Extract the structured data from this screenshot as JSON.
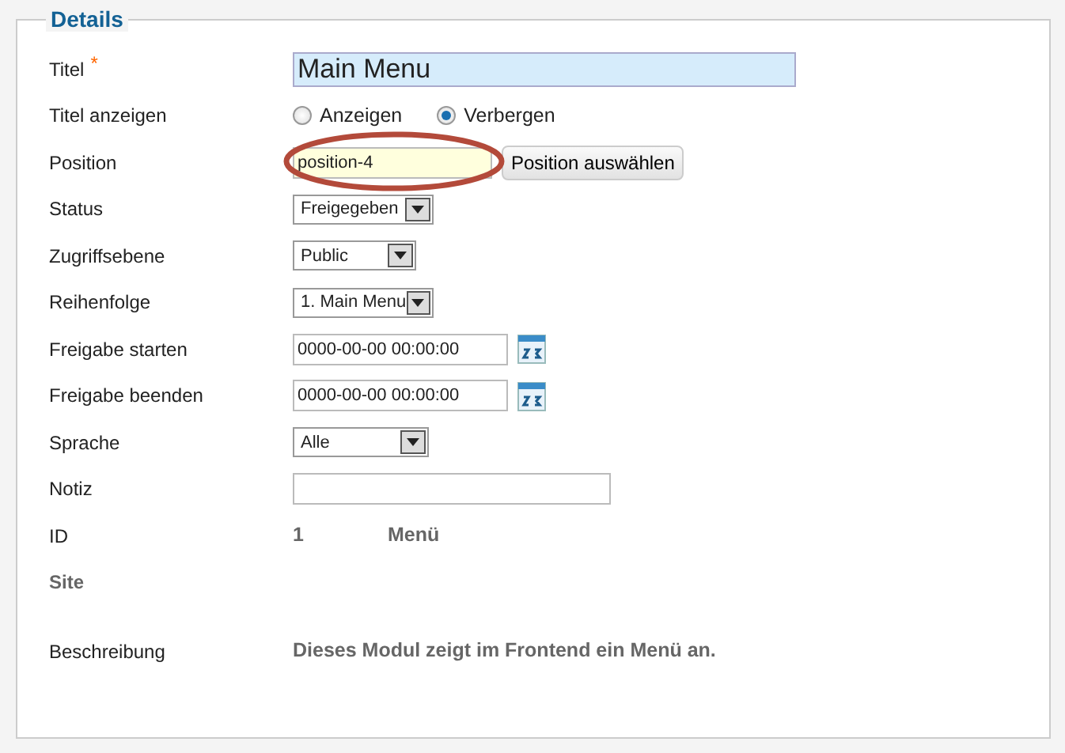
{
  "legend": "Details",
  "fields": [
    {
      "kind": "text",
      "label": "Titel",
      "required": true,
      "required_mark": "*",
      "value": "Main Menu",
      "focused": true,
      "large": true
    },
    {
      "kind": "radio",
      "label": "Titel anzeigen",
      "options": [
        {
          "label": "Anzeigen",
          "selected": false
        },
        {
          "label": "Verbergen",
          "selected": true
        }
      ]
    },
    {
      "kind": "picker",
      "label": "Position",
      "value": "position-4",
      "readonly": true,
      "annotated": true,
      "button": "Position auswählen"
    },
    {
      "kind": "select",
      "label": "Status",
      "value": "Freigegeben"
    },
    {
      "kind": "select",
      "label": "Zugriffsebene",
      "value": "Public"
    },
    {
      "kind": "select",
      "label": "Reihenfolge",
      "value": "1. Main Menu"
    },
    {
      "kind": "date",
      "label": "Freigabe starten",
      "value": "0000-00-00 00:00:00"
    },
    {
      "kind": "date",
      "label": "Freigabe beenden",
      "value": "0000-00-00 00:00:00"
    },
    {
      "kind": "select",
      "label": "Sprache",
      "value": "Alle"
    },
    {
      "kind": "text",
      "label": "Notiz"
    },
    {
      "kind": "static",
      "label": "ID",
      "values": [
        "1",
        "Menü"
      ]
    },
    {
      "kind": "heading",
      "label": "Site"
    },
    {
      "kind": "description",
      "label": "Beschreibung",
      "value": "Dieses Modul zeigt im Frontend ein Menü an."
    }
  ]
}
